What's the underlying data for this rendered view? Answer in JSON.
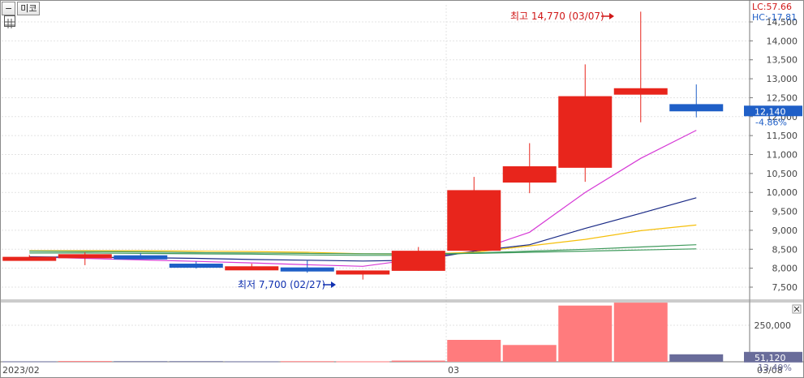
{
  "toolbar": {
    "collapse_icon": "minus-box-icon",
    "stock_name": "미코",
    "grid_icon": "table-grid-icon"
  },
  "price_panel": {
    "lc_label": "LC:57.66",
    "hc_label": "HC:-17.81",
    "current_price_label": "12,140",
    "change_label": "-4.86%",
    "high_annotation": "최고 14,770 (03/07)",
    "low_annotation": "최저 7,700 (02/27)"
  },
  "volume_panel": {
    "current_volume_label": "51,120",
    "ratio_label": "13.49%",
    "close_icon": "close-x-icon"
  },
  "colors": {
    "up": "#e8251c",
    "down": "#1f5fc7",
    "volume_up": "#ff7b7d",
    "volume_down": "#696c9a",
    "ma_magenta": "#d63ad6",
    "ma_navy": "#1a2a86",
    "ma_yellow": "#f5bf0a",
    "ma_green": "#3f9a5c",
    "annotation_red": "#d01818",
    "annotation_blue": "#1030b0"
  },
  "chart_data": {
    "type": "candlestick",
    "price_axis": {
      "ylim": [
        7200,
        14950
      ],
      "ticks": [
        "7,500",
        "8,000",
        "8,500",
        "9,000",
        "9,500",
        "10,000",
        "10,500",
        "11,000",
        "11,500",
        "12,000",
        "12,500",
        "13,000",
        "13,500",
        "14,000",
        "14,500"
      ]
    },
    "x_axis": {
      "labels": [
        {
          "label": "2023/02",
          "index": 0
        },
        {
          "label": "03",
          "index": 8
        },
        {
          "label": "03/08",
          "index": 13.5
        }
      ]
    },
    "candles": [
      {
        "open": 8300,
        "high": 8350,
        "low": 8280,
        "close": 8300
      },
      {
        "open": 8280,
        "high": 8420,
        "low": 8080,
        "close": 8370
      },
      {
        "open": 8340,
        "high": 8400,
        "low": 8260,
        "close": 8310
      },
      {
        "open": 8120,
        "high": 8180,
        "low": 7990,
        "close": 8070
      },
      {
        "open": 8050,
        "high": 8120,
        "low": 7950,
        "close": 8050
      },
      {
        "open": 8020,
        "high": 8200,
        "low": 7880,
        "close": 7940
      },
      {
        "open": 7930,
        "high": 7940,
        "low": 7700,
        "close": 7940
      },
      {
        "open": 7930,
        "high": 8560,
        "low": 7930,
        "close": 8460
      },
      {
        "open": 8460,
        "high": 10410,
        "low": 8460,
        "close": 10060
      },
      {
        "open": 10260,
        "high": 11300,
        "low": 9980,
        "close": 10690
      },
      {
        "open": 10650,
        "high": 13380,
        "low": 10280,
        "close": 12540
      },
      {
        "open": 12580,
        "high": 14770,
        "low": 11850,
        "close": 12750
      },
      {
        "open": 12330,
        "high": 12850,
        "low": 11980,
        "close": 12140
      }
    ],
    "moving_averages": [
      {
        "color": "#d63ad6",
        "values": [
          8300,
          8260,
          8220,
          8180,
          8140,
          8090,
          8050,
          8250,
          8450,
          8950,
          10000,
          10900,
          11640
        ]
      },
      {
        "color": "#1a2a86",
        "values": [
          8300,
          8290,
          8280,
          8260,
          8230,
          8210,
          8190,
          8210,
          8450,
          8620,
          9050,
          9450,
          9860
        ]
      },
      {
        "color": "#f5bf0a",
        "values": [
          8460,
          8460,
          8460,
          8450,
          8440,
          8420,
          8380,
          8370,
          8420,
          8590,
          8760,
          8990,
          9140
        ]
      },
      {
        "color": "#3f9a5c",
        "values": [
          8400,
          8400,
          8390,
          8380,
          8370,
          8350,
          8340,
          8340,
          8400,
          8450,
          8500,
          8560,
          8620
        ]
      },
      {
        "color": "#3f9a5c",
        "values": [
          8450,
          8440,
          8430,
          8410,
          8400,
          8390,
          8380,
          8380,
          8390,
          8420,
          8450,
          8480,
          8510
        ]
      }
    ],
    "volume": {
      "ylim": [
        0,
        400000
      ],
      "ticks": [
        "250,000"
      ],
      "values": [
        3000,
        5000,
        4000,
        4000,
        3000,
        4000,
        3000,
        8000,
        150000,
        115000,
        385000,
        405000,
        51120
      ],
      "direction": [
        "down",
        "up",
        "down",
        "down",
        "down",
        "up",
        "up",
        "up",
        "up",
        "up",
        "up",
        "up",
        "down"
      ]
    }
  }
}
